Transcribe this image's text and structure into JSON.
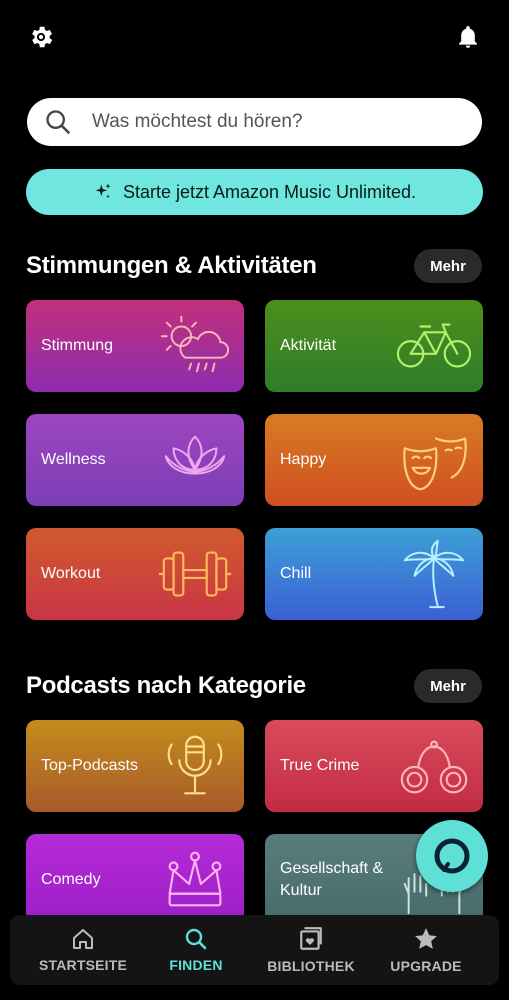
{
  "colors": {
    "accent": "#5fe0d7",
    "promo_bg": "#6fe7de",
    "background": "#000000"
  },
  "topbar": {
    "settings_icon": "gear-icon",
    "notifications_icon": "bell-icon"
  },
  "search": {
    "placeholder": "Was möchtest du hören?",
    "icon": "search-icon"
  },
  "promo": {
    "label": "Starte jetzt Amazon Music Unlimited.",
    "icon": "sparkle-icon"
  },
  "moods": {
    "title": "Stimmungen & Aktivitäten",
    "more_label": "Mehr",
    "tiles": [
      {
        "label": "Stimmung",
        "icon": "weather-icon"
      },
      {
        "label": "Aktivität",
        "icon": "bicycle-icon"
      },
      {
        "label": "Wellness",
        "icon": "lotus-icon"
      },
      {
        "label": "Happy",
        "icon": "theater-mask-icon"
      },
      {
        "label": "Workout",
        "icon": "dumbbell-icon"
      },
      {
        "label": "Chill",
        "icon": "palm-tree-icon"
      }
    ]
  },
  "podcasts": {
    "title": "Podcasts nach Kategorie",
    "more_label": "Mehr",
    "tiles": [
      {
        "label": "Top-Podcasts",
        "icon": "microphone-icon"
      },
      {
        "label": "True Crime",
        "icon": "handcuffs-icon"
      },
      {
        "label": "Comedy",
        "icon": "jester-hat-icon"
      },
      {
        "label": "Gesellschaft & Kultur",
        "icon": "raised-hands-icon"
      }
    ]
  },
  "alexa": {
    "icon": "alexa-icon"
  },
  "bottom_nav": {
    "items": [
      {
        "label": "STARTSEITE",
        "icon": "home-icon",
        "active": false
      },
      {
        "label": "FINDEN",
        "icon": "search-icon",
        "active": true
      },
      {
        "label": "BIBLIOTHEK",
        "icon": "library-icon",
        "active": false
      },
      {
        "label": "UPGRADE",
        "icon": "star-icon",
        "active": false
      }
    ]
  }
}
